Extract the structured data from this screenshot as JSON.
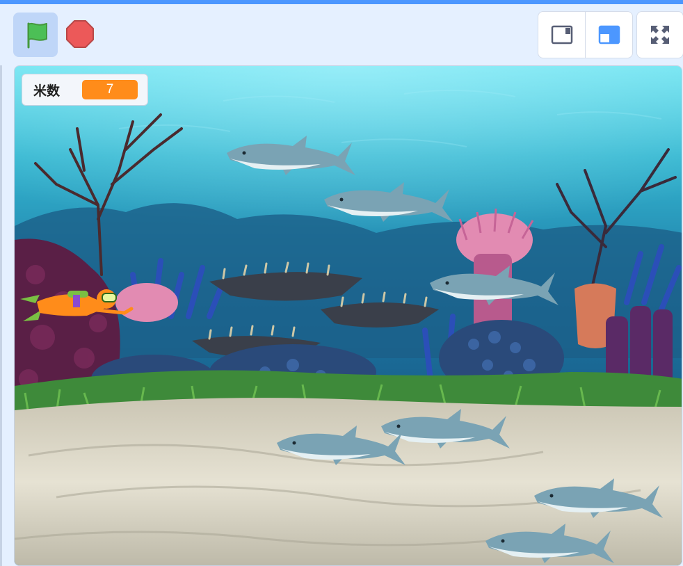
{
  "toolbar": {
    "green_flag_icon": "green-flag-icon",
    "stop_icon": "stop-sign-icon",
    "small_stage_icon": "small-stage-layout-icon",
    "normal_stage_icon": "normal-stage-layout-icon",
    "fullscreen_icon": "fullscreen-icon"
  },
  "stage": {
    "backdrop": "underwater",
    "sprites": [
      "diver",
      "shark",
      "shark",
      "shark",
      "shark",
      "shark",
      "shark",
      "shark"
    ]
  },
  "monitor": {
    "label": "米数",
    "value": "7"
  },
  "colors": {
    "accent": "#4c97ff",
    "monitor_value_bg": "#ff8c1a",
    "flag": "#4cbf56",
    "stop": "#ec5959"
  }
}
